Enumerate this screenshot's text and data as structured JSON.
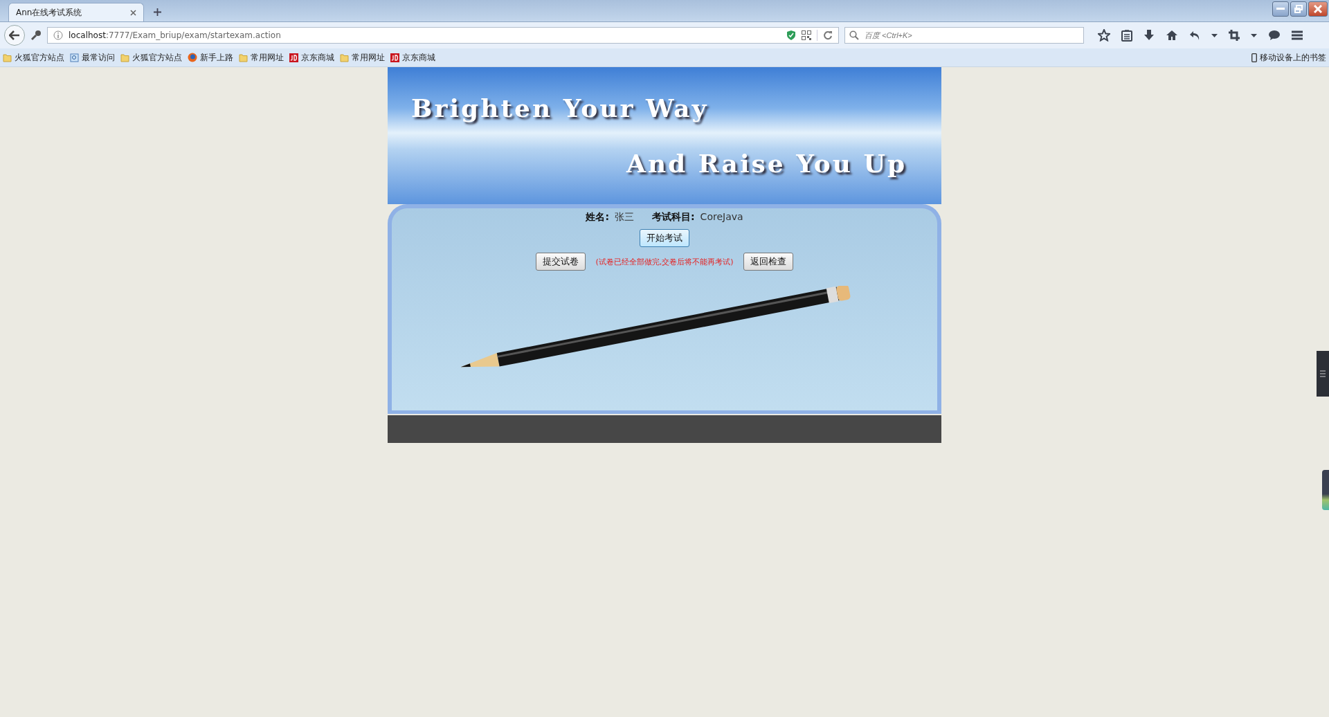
{
  "browser": {
    "tabs": [
      {
        "title": "Ann在线考试系统",
        "selected": true
      }
    ],
    "url_host": "localhost",
    "url_rest": ":7777/Exam_briup/exam/startexam.action",
    "search": {
      "placeholder": "百度 <Ctrl+K>"
    },
    "bookmarks": [
      {
        "label": "火狐官方站点",
        "kind": "folder"
      },
      {
        "label": "最常访问",
        "kind": "page"
      },
      {
        "label": "火狐官方站点",
        "kind": "folder"
      },
      {
        "label": "新手上路",
        "kind": "firefox"
      },
      {
        "label": "常用网址",
        "kind": "folder"
      },
      {
        "label": "京东商城",
        "kind": "jd"
      },
      {
        "label": "常用网址",
        "kind": "folder"
      },
      {
        "label": "京东商城",
        "kind": "jd"
      }
    ],
    "mobile_bookmarks": "移动设备上的书签"
  },
  "banner": {
    "line_1": "Brighten Your Way",
    "line_2": "And Raise You Up"
  },
  "exam": {
    "name_label": "姓名:",
    "name_value": "张三",
    "subject_label": "考试科目:",
    "subject_value": "CoreJava",
    "start_button": "开始考试",
    "submit_button": "提交试卷",
    "warning": "(试卷已经全部做完,交卷后将不能再考试)",
    "review_button": "返回检查"
  }
}
